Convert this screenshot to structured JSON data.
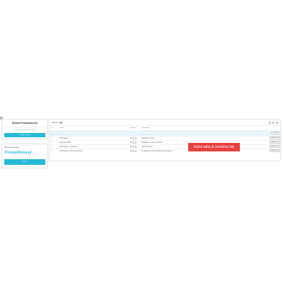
{
  "left": {
    "promo_panel": {
      "title": "Moduł Przeszukania",
      "hint": "Instrukcja konfiguracji modułu",
      "button": "Konfiguruj moduł"
    },
    "brand_panel": {
      "label": "Wyprodukowano",
      "logo": "PrestaShow.pl",
      "button": "SKLEP"
    }
  },
  "main": {
    "title": "Sekcje",
    "count": "6",
    "columns": [
      "ID",
      "Nazwa",
      "Pozycja",
      "Opis/Adres"
    ],
    "filter_button": "Szukaj",
    "rows": [
      {
        "id": "1",
        "name": "Informacje",
        "position": "1",
        "desc": "kategorie i sklep"
      },
      {
        "id": "2",
        "name": "Dane produktu",
        "position": "2",
        "desc": "kategorie i cechy produktu"
      },
      {
        "id": "3",
        "name": "Informacje o produkcie",
        "position": "3",
        "desc": "Opis produktu"
      },
      {
        "id": "4",
        "name": "Informacje o ochronie danych",
        "position": "4",
        "desc": "W zakresie ochrony danych osobowych"
      }
    ],
    "edit_label": "Edytuj"
  },
  "callout": "Extra tabs & sections list"
}
